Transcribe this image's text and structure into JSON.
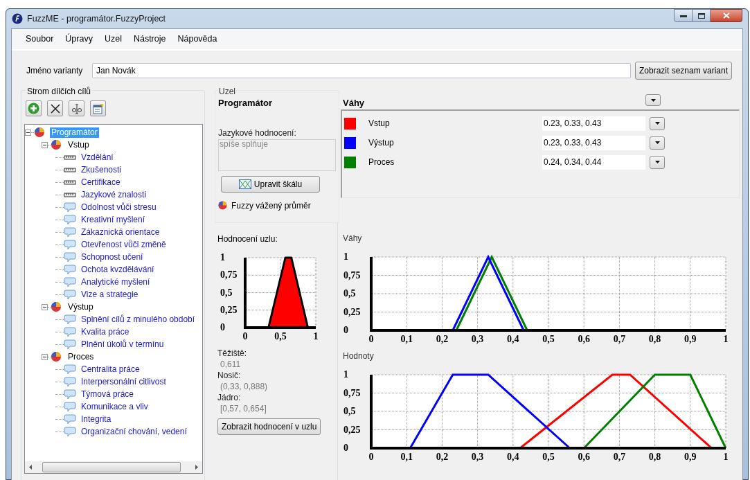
{
  "window": {
    "title": "FuzzME - programátor.FuzzyProject"
  },
  "menu": [
    "Soubor",
    "Úpravy",
    "Uzel",
    "Nástroje",
    "Nápověda"
  ],
  "variant": {
    "label": "Jméno varianty",
    "value": "Jan Novák",
    "button": "Zobrazit seznam variant"
  },
  "tree_panel": {
    "title": "Strom dílčích cílů",
    "tree": [
      {
        "label": "Programátor",
        "kind": "group",
        "selected": true,
        "expanded": true,
        "children": [
          {
            "label": "Vstup",
            "kind": "group",
            "selected": false,
            "expanded": true,
            "children": [
              {
                "label": "Vzdělání",
                "kind": "scale",
                "selected": false
              },
              {
                "label": "Zkušenosti",
                "kind": "scale",
                "selected": false
              },
              {
                "label": "Certifikace",
                "kind": "scale",
                "selected": false
              },
              {
                "label": "Jazykové znalosti",
                "kind": "scale",
                "selected": false
              },
              {
                "label": "Odolnost vůči stresu",
                "kind": "comment",
                "selected": false
              },
              {
                "label": "Kreativní myšlení",
                "kind": "comment",
                "selected": false
              },
              {
                "label": "Zákaznická orientace",
                "kind": "comment",
                "selected": false
              },
              {
                "label": "Otevřenost vůči změně",
                "kind": "comment",
                "selected": false
              },
              {
                "label": "Schopnost učení",
                "kind": "comment",
                "selected": false
              },
              {
                "label": "Ochota kvzdělávání",
                "kind": "comment",
                "selected": false
              },
              {
                "label": "Analytické myšlení",
                "kind": "comment",
                "selected": false
              },
              {
                "label": "Vize a strategie",
                "kind": "comment",
                "selected": false
              }
            ]
          },
          {
            "label": "Výstup",
            "kind": "group",
            "selected": false,
            "expanded": true,
            "children": [
              {
                "label": "Splnění cílů z minulého období",
                "kind": "comment",
                "selected": false
              },
              {
                "label": "Kvalita práce",
                "kind": "comment",
                "selected": false
              },
              {
                "label": "Plnění úkolů v termínu",
                "kind": "comment",
                "selected": false
              }
            ]
          },
          {
            "label": "Proces",
            "kind": "group",
            "selected": false,
            "expanded": true,
            "children": [
              {
                "label": "Centralita práce",
                "kind": "comment",
                "selected": false
              },
              {
                "label": "Interpersonální citlivost",
                "kind": "comment",
                "selected": false
              },
              {
                "label": "Týmová práce",
                "kind": "comment",
                "selected": false
              },
              {
                "label": "Komunikace a vliv",
                "kind": "comment",
                "selected": false
              },
              {
                "label": "Integrita",
                "kind": "comment",
                "selected": false
              },
              {
                "label": "Organizační chování, vedení",
                "kind": "comment",
                "selected": false
              }
            ]
          }
        ]
      }
    ]
  },
  "node_panel": {
    "title": "Uzel",
    "node_name": "Programátor",
    "linguistic_label": "Jazykové hodnocení:",
    "linguistic_value": "spíše splňuje",
    "edit_scale_button": "Upravit škálu",
    "method": "Fuzzy vážený průměr",
    "evaluation_label": "Hodnocení uzlu:",
    "chart_data": {
      "type": "area",
      "xlim": [
        0,
        1
      ],
      "ylim": [
        0,
        1
      ],
      "xticks": [
        0,
        {
          "value": 0.5,
          "label": "0,5"
        },
        1
      ],
      "yticks": [
        0,
        {
          "value": 0.25,
          "label": "0,25"
        },
        {
          "value": 0.5,
          "label": "0,5"
        },
        {
          "value": 0.75,
          "label": "0,75"
        },
        1
      ],
      "grid": true,
      "series": [
        {
          "color": "#ff0000",
          "x": [
            0.33,
            0.57,
            0.654,
            0.888
          ],
          "values": [
            0,
            1,
            1,
            0
          ]
        }
      ]
    },
    "stats": [
      {
        "label": "Těžiště:",
        "value": "0,611"
      },
      {
        "label": "Nosič:",
        "value": "(0,33, 0,888)"
      },
      {
        "label": "Jádro:",
        "value": "[0,57, 0,654]"
      }
    ],
    "show_button": "Zobrazit hodnocení v uzlu"
  },
  "weights": {
    "title": "Váhy",
    "items": [
      {
        "name": "Vstup",
        "color": "#ff0000",
        "value": "0.23, 0.33, 0.43"
      },
      {
        "name": "Výstup",
        "color": "#0000ff",
        "value": "0.23, 0.33, 0.43"
      },
      {
        "name": "Proces",
        "color": "#008000",
        "value": "0.24, 0.34, 0.44"
      }
    ]
  },
  "weights_chart": {
    "title": "Váhy",
    "chart_data": {
      "type": "line",
      "xlim": [
        0,
        1
      ],
      "ylim": [
        0,
        1
      ],
      "xticks": [
        0,
        {
          "value": 0.1,
          "label": "0,1"
        },
        {
          "value": 0.2,
          "label": "0,2"
        },
        {
          "value": 0.3,
          "label": "0,3"
        },
        {
          "value": 0.4,
          "label": "0,4"
        },
        {
          "value": 0.5,
          "label": "0,5"
        },
        {
          "value": 0.6,
          "label": "0,6"
        },
        {
          "value": 0.7,
          "label": "0,7"
        },
        {
          "value": 0.8,
          "label": "0,8"
        },
        {
          "value": 0.9,
          "label": "0,9"
        },
        1
      ],
      "yticks": [
        0,
        {
          "value": 0.25,
          "label": "0,25"
        },
        {
          "value": 0.5,
          "label": "0,5"
        },
        {
          "value": 0.75,
          "label": "0,75"
        },
        1
      ],
      "series": [
        {
          "color": "#008000",
          "x": [
            0.24,
            0.34,
            0.44
          ],
          "values": [
            0,
            1,
            0
          ]
        },
        {
          "color": "#0000ff",
          "x": [
            0.23,
            0.33,
            0.43
          ],
          "values": [
            0,
            1,
            0
          ]
        }
      ],
      "grid": true
    }
  },
  "values_chart": {
    "title": "Hodnoty",
    "chart_data": {
      "type": "line",
      "xlim": [
        0,
        1
      ],
      "ylim": [
        0,
        1
      ],
      "xticks": [
        0,
        {
          "value": 0.1,
          "label": "0,1"
        },
        {
          "value": 0.2,
          "label": "0,2"
        },
        {
          "value": 0.3,
          "label": "0,3"
        },
        {
          "value": 0.4,
          "label": "0,4"
        },
        {
          "value": 0.5,
          "label": "0,5"
        },
        {
          "value": 0.6,
          "label": "0,6"
        },
        {
          "value": 0.7,
          "label": "0,7"
        },
        {
          "value": 0.8,
          "label": "0,8"
        },
        {
          "value": 0.9,
          "label": "0,9"
        },
        1
      ],
      "yticks": [
        0,
        {
          "value": 0.25,
          "label": "0,25"
        },
        {
          "value": 0.5,
          "label": "0,5"
        },
        {
          "value": 0.75,
          "label": "0,75"
        },
        1
      ],
      "series": [
        {
          "color": "#ff0000",
          "x": [
            0.42,
            0.68,
            0.73,
            0.96
          ],
          "values": [
            0,
            1,
            1,
            0
          ]
        },
        {
          "color": "#0000ff",
          "x": [
            0.11,
            0.23,
            0.33,
            0.56
          ],
          "values": [
            0,
            1,
            1,
            0
          ]
        },
        {
          "color": "#008000",
          "x": [
            0.6,
            0.8,
            0.9,
            1
          ],
          "values": [
            0,
            1,
            1,
            0
          ]
        }
      ],
      "grid": true
    }
  }
}
